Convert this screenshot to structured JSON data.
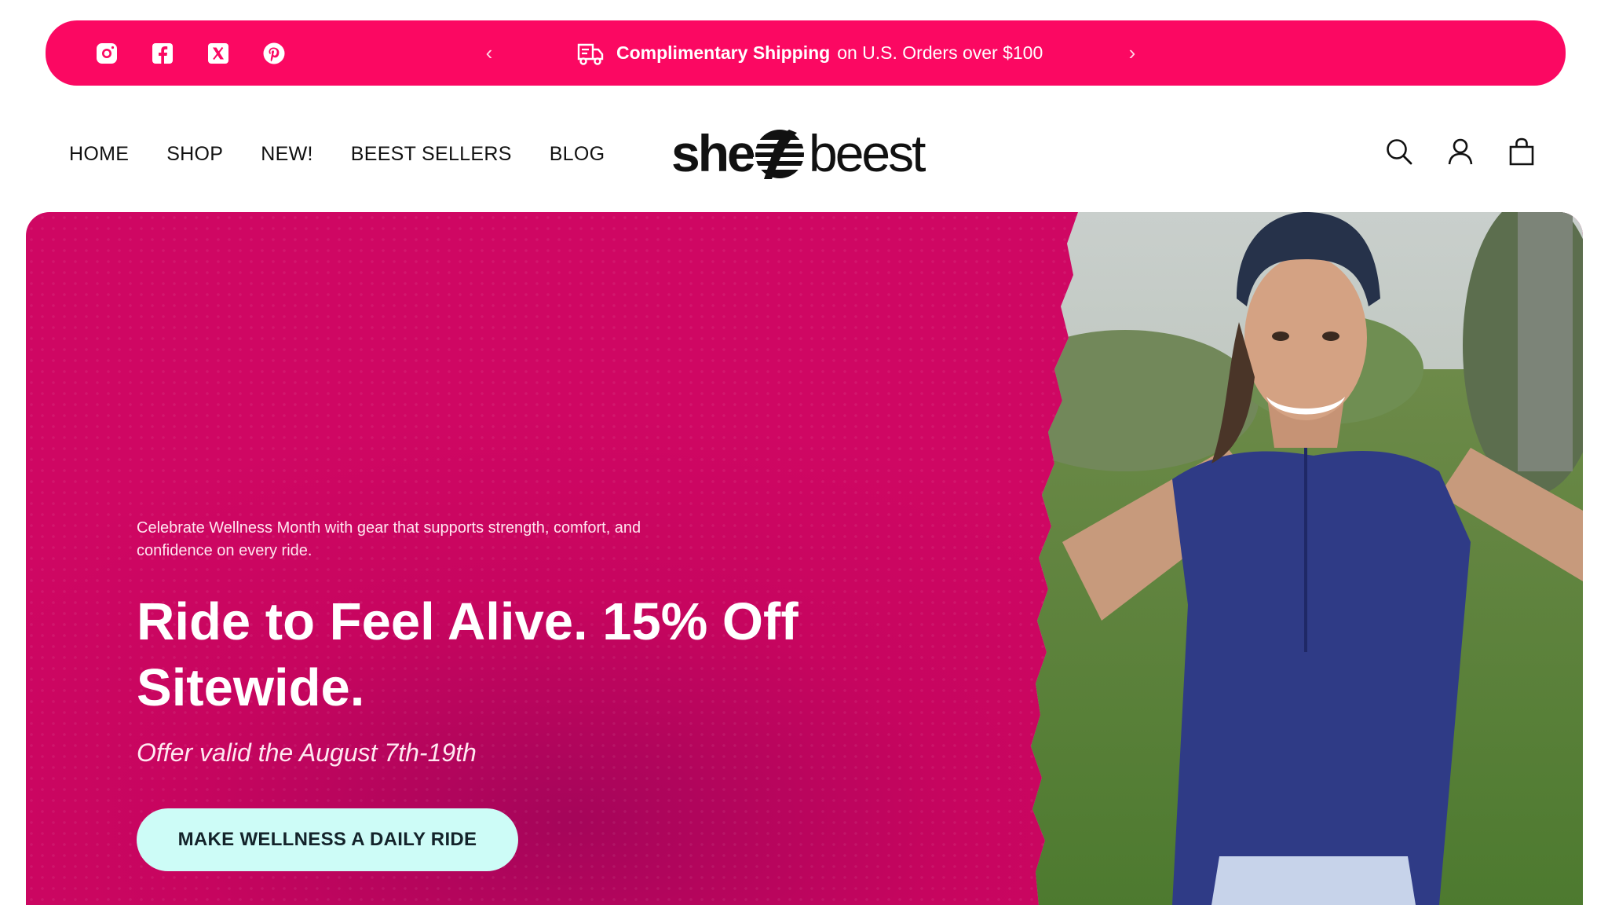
{
  "announcement": {
    "social_icons": [
      "instagram-icon",
      "facebook-icon",
      "x-twitter-icon",
      "pinterest-icon"
    ],
    "prev_arrow": "‹",
    "next_arrow": "›",
    "icon": "shipping-truck-icon",
    "message_bold": "Complimentary Shipping",
    "message_rest": "on U.S. Orders over $100",
    "background_color": "#fb0862"
  },
  "nav": {
    "items": [
      {
        "label": "HOME"
      },
      {
        "label": "SHOP"
      },
      {
        "label": "NEW!"
      },
      {
        "label": "BEEST SELLERS"
      },
      {
        "label": "BLOG"
      }
    ]
  },
  "logo": {
    "text_left": "she",
    "text_right": "beest"
  },
  "header_icons": [
    "search-icon",
    "account-icon",
    "cart-icon"
  ],
  "hero": {
    "intro": "Celebrate Wellness Month with gear that supports strength, comfort, and confidence on every ride.",
    "title": "Ride to Feel Alive. 15% Off Sitewide.",
    "validity": "Offer valid the August 7th-19th",
    "cta_label": "MAKE WELLNESS A DAILY RIDE",
    "background_color": "#c7055f",
    "cta_color": "#cdfcf7"
  }
}
